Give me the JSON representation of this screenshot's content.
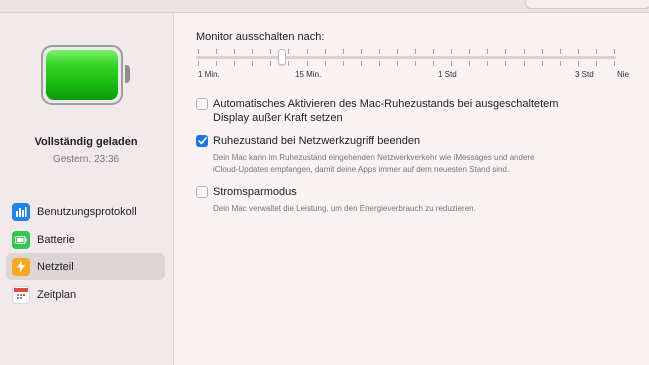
{
  "sidebar": {
    "status_title": "Vollständig geladen",
    "status_time": "Gestern, 23:36",
    "battery_level": 1.0,
    "items": [
      {
        "label": "Benutzungsprotokoll",
        "icon": "usage-chart-icon",
        "color": "#1e84f0"
      },
      {
        "label": "Batterie",
        "icon": "battery-icon",
        "color": "#34c74a"
      },
      {
        "label": "Netzteil",
        "icon": "power-adapter-icon",
        "color": "#f7a91b",
        "selected": true
      },
      {
        "label": "Zeitplan",
        "icon": "calendar-icon",
        "color": "#ffffff"
      }
    ]
  },
  "display_off": {
    "label": "Monitor ausschalten nach:",
    "selected": "15 Min.",
    "tick_labels": [
      "1 Min.",
      "15 Min.",
      "1 Std",
      "3 Std",
      "Nie"
    ]
  },
  "options": [
    {
      "label": "Automatisches Aktivieren des Mac-Ruhezustands bei ausgeschaltetem",
      "label2": "Display außer Kraft setzen",
      "checked": false
    },
    {
      "label": "Ruhezustand bei Netzwerkzugriff beenden",
      "checked": true,
      "desc1": "Dein Mac kann im Ruhezustand eingehenden Netzwerkverkehr wie iMessages und andere",
      "desc2": "iCloud-Updates empfangen, damit deine Apps immer auf dem neuesten Stand sind."
    },
    {
      "label": "Stromsparmodus",
      "checked": false,
      "desc1": "Dein Mac verwaltet die Leistung, um den Energieverbrauch zu reduzieren."
    }
  ],
  "colors": {
    "accent": "#1a73e8",
    "battery_green": "#18b914"
  }
}
